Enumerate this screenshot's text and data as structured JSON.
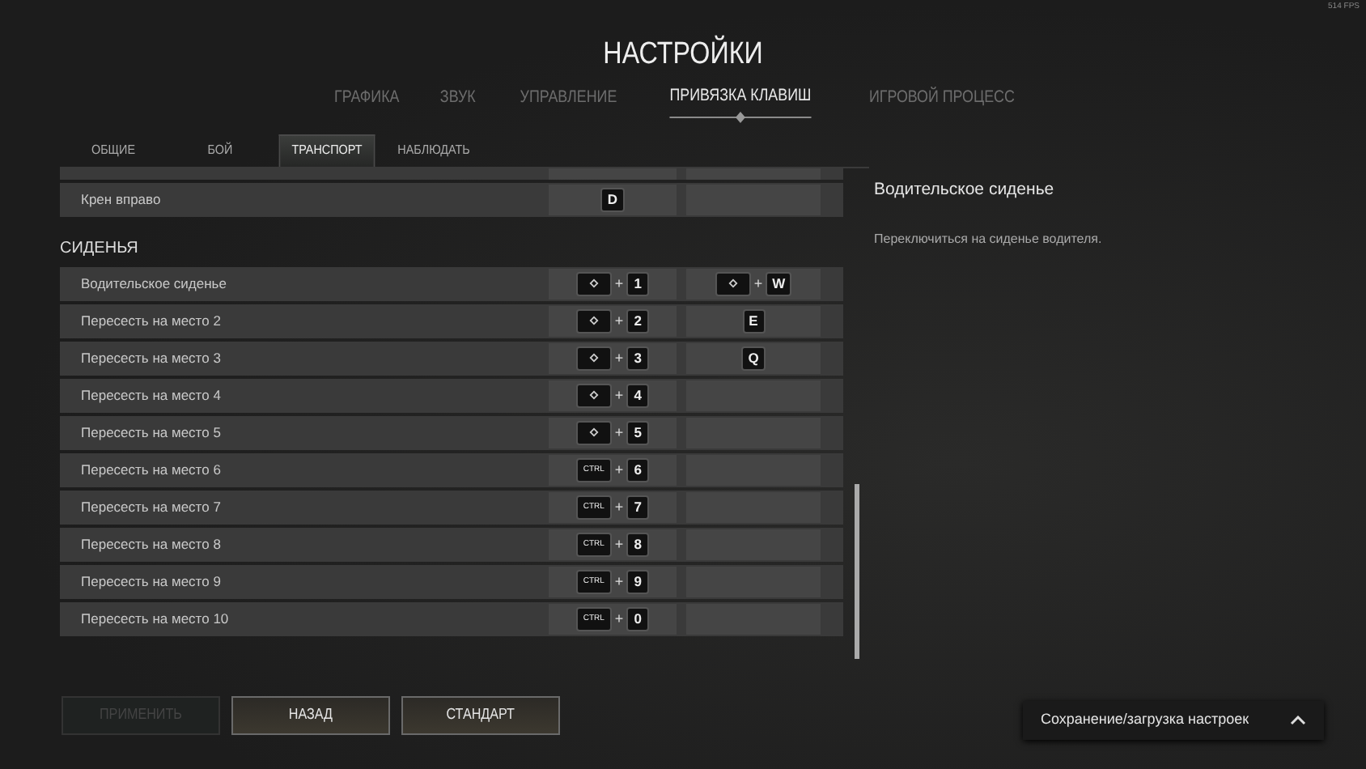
{
  "fps": "514 FPS",
  "title": "НАСТРОЙКИ",
  "tabs": [
    {
      "label": "ГРАФИКА",
      "selected": false
    },
    {
      "label": "ЗВУК",
      "selected": false
    },
    {
      "label": "УПРАВЛЕНИЕ",
      "selected": false
    },
    {
      "label": "ПРИВЯЗКА КЛАВИШ",
      "selected": true
    },
    {
      "label": "ИГРОВОЙ ПРОЦЕСС",
      "selected": false
    }
  ],
  "subtabs": [
    {
      "label": "ОБЩИЕ",
      "selected": false
    },
    {
      "label": "БОЙ",
      "selected": false
    },
    {
      "label": "ТРАНСПОРТ",
      "selected": true
    },
    {
      "label": "НАБЛЮДАТЬ",
      "selected": false
    }
  ],
  "sections": [
    {
      "rows": [
        {
          "label": "Крен вправо",
          "primary": [
            {
              "kind": "char",
              "label": "D"
            }
          ],
          "secondary": []
        }
      ]
    },
    {
      "heading": "СИДЕНЬЯ",
      "rows": [
        {
          "label": "Водительское сиденье",
          "primary": [
            {
              "kind": "shift"
            },
            {
              "kind": "char",
              "label": "1"
            }
          ],
          "secondary": [
            {
              "kind": "shift"
            },
            {
              "kind": "char",
              "label": "W"
            }
          ]
        },
        {
          "label": "Пересесть на место 2",
          "primary": [
            {
              "kind": "shift"
            },
            {
              "kind": "char",
              "label": "2"
            }
          ],
          "secondary": [
            {
              "kind": "char",
              "label": "E"
            }
          ]
        },
        {
          "label": "Пересесть на место 3",
          "primary": [
            {
              "kind": "shift"
            },
            {
              "kind": "char",
              "label": "3"
            }
          ],
          "secondary": [
            {
              "kind": "char",
              "label": "Q"
            }
          ]
        },
        {
          "label": "Пересесть на место 4",
          "primary": [
            {
              "kind": "shift"
            },
            {
              "kind": "char",
              "label": "4"
            }
          ],
          "secondary": []
        },
        {
          "label": "Пересесть на место 5",
          "primary": [
            {
              "kind": "shift"
            },
            {
              "kind": "char",
              "label": "5"
            }
          ],
          "secondary": []
        },
        {
          "label": "Пересесть на место 6",
          "primary": [
            {
              "kind": "ctrl",
              "label": "CTRL"
            },
            {
              "kind": "char",
              "label": "6"
            }
          ],
          "secondary": []
        },
        {
          "label": "Пересесть на место 7",
          "primary": [
            {
              "kind": "ctrl",
              "label": "CTRL"
            },
            {
              "kind": "char",
              "label": "7"
            }
          ],
          "secondary": []
        },
        {
          "label": "Пересесть на место 8",
          "primary": [
            {
              "kind": "ctrl",
              "label": "CTRL"
            },
            {
              "kind": "char",
              "label": "8"
            }
          ],
          "secondary": []
        },
        {
          "label": "Пересесть на место 9",
          "primary": [
            {
              "kind": "ctrl",
              "label": "CTRL"
            },
            {
              "kind": "char",
              "label": "9"
            }
          ],
          "secondary": []
        },
        {
          "label": "Пересесть на место 10",
          "primary": [
            {
              "kind": "ctrl",
              "label": "CTRL"
            },
            {
              "kind": "char",
              "label": "0"
            }
          ],
          "secondary": []
        }
      ]
    }
  ],
  "plus": "+",
  "detail": {
    "title": "Водительское сиденье",
    "text": "Переключиться на сиденье водителя."
  },
  "buttons": [
    {
      "label": "ПРИМЕНИТЬ",
      "disabled": true
    },
    {
      "label": "НАЗАД",
      "disabled": false
    },
    {
      "label": "СТАНДАРТ",
      "disabled": false
    }
  ],
  "preset_menu": {
    "label": "Сохранение/загрузка настроек",
    "expanded": false
  }
}
